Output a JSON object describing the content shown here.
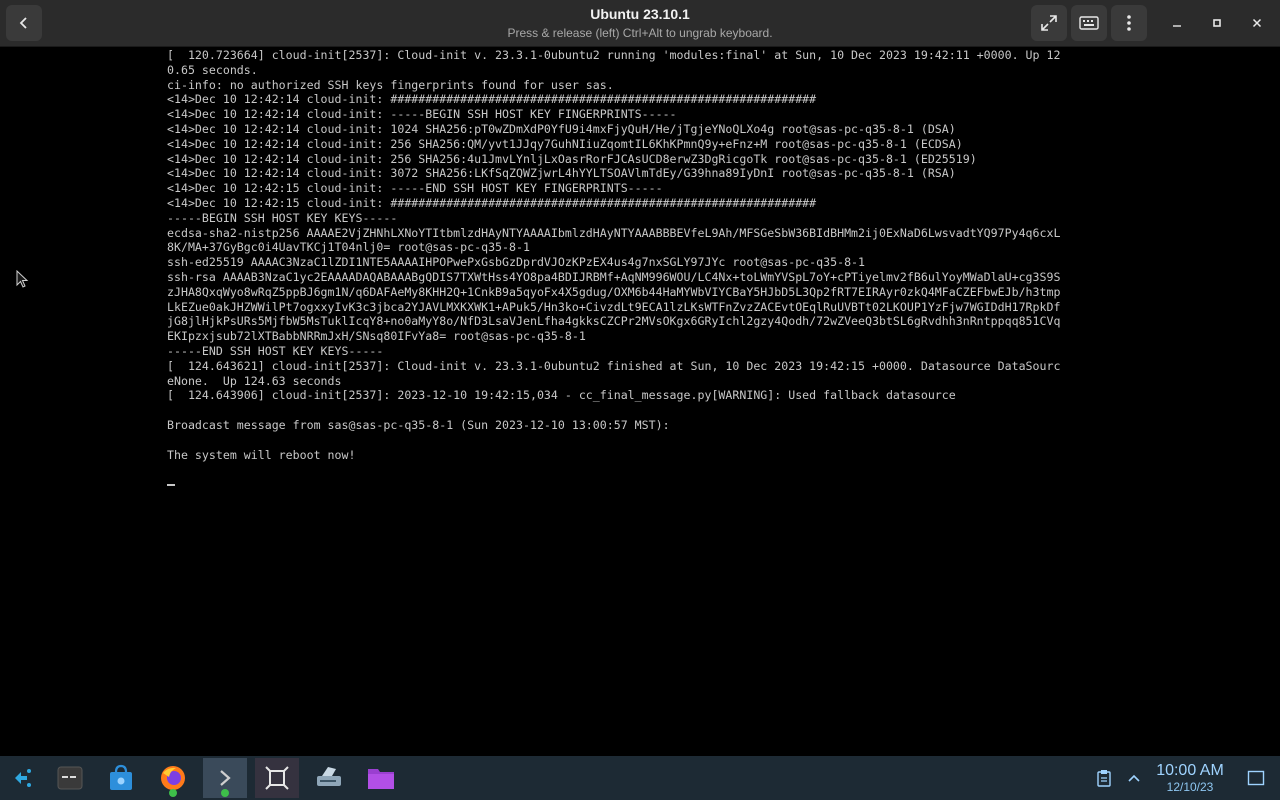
{
  "header": {
    "title": "Ubuntu 23.10.1",
    "subtitle": "Press & release (left) Ctrl+Alt to ungrab keyboard."
  },
  "terminal": {
    "lines": [
      "[  120.723664] cloud-init[2537]: Cloud-init v. 23.3.1-0ubuntu2 running 'modules:final' at Sun, 10 Dec 2023 19:42:11 +0000. Up 12",
      "0.65 seconds.",
      "ci-info: no authorized SSH keys fingerprints found for user sas.",
      "<14>Dec 10 12:42:14 cloud-init: #############################################################",
      "<14>Dec 10 12:42:14 cloud-init: -----BEGIN SSH HOST KEY FINGERPRINTS-----",
      "<14>Dec 10 12:42:14 cloud-init: 1024 SHA256:pT0wZDmXdP0YfU9i4mxFjyQuH/He/jTgjeYNoQLXo4g root@sas-pc-q35-8-1 (DSA)",
      "<14>Dec 10 12:42:14 cloud-init: 256 SHA256:QM/yvt1JJqy7GuhNIiuZqomtIL6KhKPmnQ9y+eFnz+M root@sas-pc-q35-8-1 (ECDSA)",
      "<14>Dec 10 12:42:14 cloud-init: 256 SHA256:4u1JmvLYnljLxOasrRorFJCAsUCD8erwZ3DgRicgoTk root@sas-pc-q35-8-1 (ED25519)",
      "<14>Dec 10 12:42:14 cloud-init: 3072 SHA256:LKfSqZQWZjwrL4hYYLTSOAVlmTdEy/G39hna89IyDnI root@sas-pc-q35-8-1 (RSA)",
      "<14>Dec 10 12:42:15 cloud-init: -----END SSH HOST KEY FINGERPRINTS-----",
      "<14>Dec 10 12:42:15 cloud-init: #############################################################",
      "-----BEGIN SSH HOST KEY KEYS-----",
      "ecdsa-sha2-nistp256 AAAAE2VjZHNhLXNoYTItbmlzdHAyNTYAAAAIbmlzdHAyNTYAAABBBEVfeL9Ah/MFSGeSbW36BIdBHMm2ij0ExNaD6LwsvadtYQ97Py4q6cxL",
      "8K/MA+37GyBgc0i4UavTKCj1T04nlj0= root@sas-pc-q35-8-1",
      "ssh-ed25519 AAAAC3NzaC1lZDI1NTE5AAAAIHPOPwePxGsbGzDprdVJOzKPzEX4us4g7nxSGLY97JYc root@sas-pc-q35-8-1",
      "ssh-rsa AAAAB3NzaC1yc2EAAAADAQABAAABgQDIS7TXWtHss4YO8pa4BDIJRBMf+AqNM996WOU/LC4Nx+toLWmYVSpL7oY+cPTiyelmv2fB6ulYoyMWaDlaU+cg3S9S",
      "zJHA8QxqWyo8wRqZ5ppBJ6gm1N/q6DAFAeMy8KHH2Q+1CnkB9a5qyoFx4X5gdug/OXM6b44HaMYWbVIYCBaY5HJbD5L3Qp2fRT7EIRAyr0zkQ4MFaCZEFbwEJb/h3tmp",
      "LkEZue0akJHZWWilPt7ogxxyIvK3c3jbca2YJAVLMXKXWK1+APuk5/Hn3ko+CivzdLt9ECA1lzLKsWTFnZvzZACEvtOEqlRuUVBTt02LKOUP1YzFjw7WGIDdH17RpkDf",
      "jG8jlHjkPsURs5MjfbW5MsTuklIcqY8+no0aMyY8o/NfD3LsaVJenLfha4gkksCZCPr2MVsOKgx6GRyIchl2gzy4Qodh/72wZVeeQ3btSL6gRvdhh3nRntppqq851CVq",
      "EKIpzxjsub72lXTBabbNRRmJxH/SNsq80IFvYa8= root@sas-pc-q35-8-1",
      "-----END SSH HOST KEY KEYS-----",
      "[  124.643621] cloud-init[2537]: Cloud-init v. 23.3.1-0ubuntu2 finished at Sun, 10 Dec 2023 19:42:15 +0000. Datasource DataSourc",
      "eNone.  Up 124.63 seconds",
      "[  124.643906] cloud-init[2537]: 2023-12-10 19:42:15,034 - cc_final_message.py[WARNING]: Used fallback datasource",
      "",
      "Broadcast message from sas@sas-pc-q35-8-1 (Sun 2023-12-10 13:00:57 MST):",
      "",
      "The system will reboot now!",
      ""
    ]
  },
  "taskbar": {
    "apps": [
      "launcher-icon",
      "terminal-icon",
      "store-icon",
      "firefox-icon",
      "console-icon",
      "workspace-icon",
      "scanner-icon",
      "files-icon"
    ],
    "clock": {
      "time": "10:00 AM",
      "date": "12/10/23"
    }
  },
  "colors": {
    "terminal_fg": "#c8c8c8",
    "header_bg": "#2b2b2b",
    "taskbar_bg": "#1d2a34",
    "clock": "#9fd3ff"
  }
}
